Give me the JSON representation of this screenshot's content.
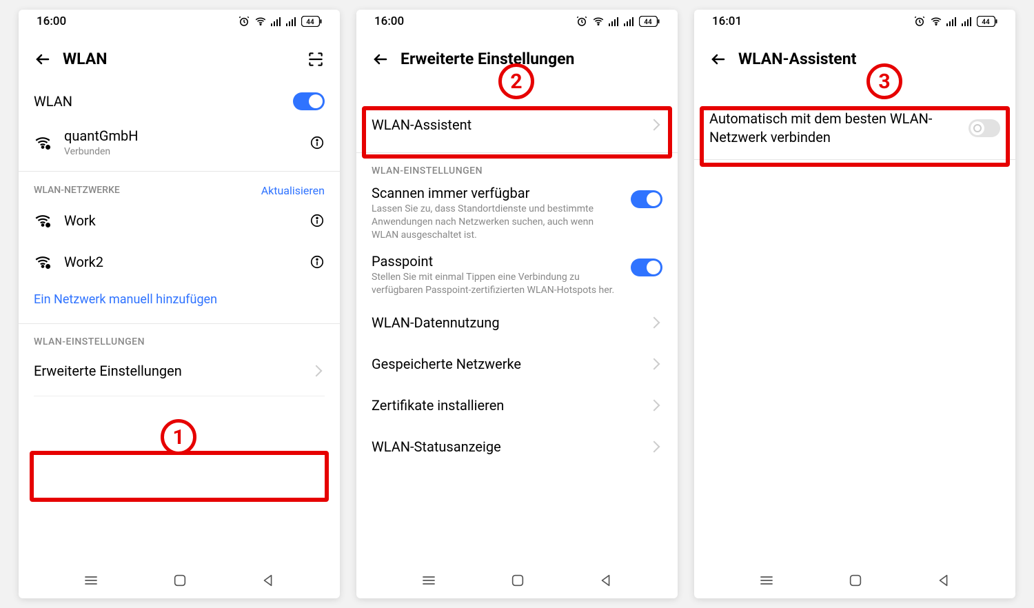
{
  "status": {
    "batt": "44"
  },
  "screen1": {
    "time": "16:00",
    "title": "WLAN",
    "wlan_toggle_label": "WLAN",
    "connected": {
      "name": "quantGmbH",
      "sub": "Verbunden"
    },
    "networks": {
      "header": "WLAN-NETZWERKE",
      "refresh": "Aktualisieren",
      "items": [
        "Work",
        "Work2"
      ],
      "add": "Ein Netzwerk manuell hinzufügen"
    },
    "settings_header": "WLAN-EINSTELLUNGEN",
    "advanced": "Erweiterte Einstellungen"
  },
  "screen2": {
    "time": "16:00",
    "title": "Erweiterte Einstellungen",
    "assistant": "WLAN-Assistent",
    "section": "WLAN-EINSTELLUNGEN",
    "scan": {
      "title": "Scannen immer verfügbar",
      "sub": "Lassen Sie zu, dass Standortdienste und bestimmte Anwendungen nach Netzwerken suchen, auch wenn WLAN ausgeschaltet ist."
    },
    "passpoint": {
      "title": "Passpoint",
      "sub": "Stellen Sie mit einmal Tippen eine Verbindung zu verfügbaren Passpoint-zertifizierten WLAN-Hotspots her."
    },
    "data": "WLAN-Datennutzung",
    "saved": "Gespeicherte Netzwerke",
    "certs": "Zertifikate installieren",
    "status": "WLAN-Statusanzeige"
  },
  "screen3": {
    "time": "16:01",
    "title": "WLAN-Assistent",
    "auto": "Automatisch mit dem besten WLAN-Netzwerk verbinden"
  }
}
